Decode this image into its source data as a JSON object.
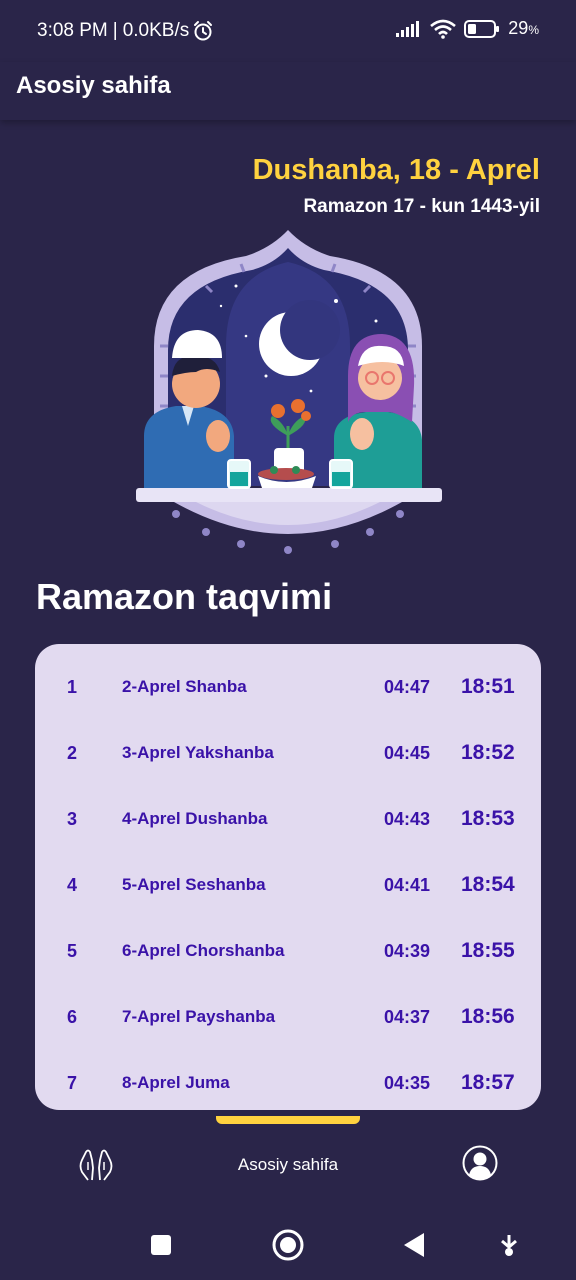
{
  "status_bar": {
    "time": "3:08 PM",
    "separator": "|",
    "speed": "0.0KB/s",
    "battery": "29",
    "battery_unit": "%",
    "alarm_icon": "alarm-icon",
    "signal_icon": "signal-icon",
    "wifi_icon": "wifi-icon",
    "battery_icon": "battery-icon"
  },
  "appbar": {
    "title": "Asosiy sahifa"
  },
  "date": {
    "main": "Dushanba, 18 - Aprel",
    "sub": "Ramazon 17 - kun 1443-yil"
  },
  "section": {
    "title": "Ramazon taqvimi"
  },
  "calendar": {
    "rows": [
      {
        "num": "1",
        "date": "2-Aprel Shanba",
        "suhur": "04:47",
        "iftar": "18:51"
      },
      {
        "num": "2",
        "date": "3-Aprel Yakshanba",
        "suhur": "04:45",
        "iftar": "18:52"
      },
      {
        "num": "3",
        "date": "4-Aprel Dushanba",
        "suhur": "04:43",
        "iftar": "18:53"
      },
      {
        "num": "4",
        "date": "5-Aprel Seshanba",
        "suhur": "04:41",
        "iftar": "18:54"
      },
      {
        "num": "5",
        "date": "6-Aprel Chorshanba",
        "suhur": "04:39",
        "iftar": "18:55"
      },
      {
        "num": "6",
        "date": "7-Aprel Payshanba",
        "suhur": "04:37",
        "iftar": "18:56"
      },
      {
        "num": "7",
        "date": "8-Aprel Juma",
        "suhur": "04:35",
        "iftar": "18:57"
      }
    ]
  },
  "bottom_nav": {
    "left_icon": "praying-hands-icon",
    "center_label": "Asosiy sahifa",
    "right_icon": "profile-icon"
  },
  "colors": {
    "background": "#2a2549",
    "accent": "#ffd23f",
    "card": "#e2daf0",
    "card_text": "#3a12a8"
  }
}
